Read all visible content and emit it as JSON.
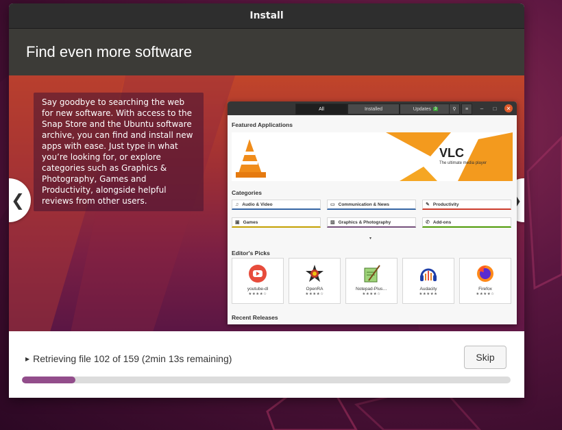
{
  "window": {
    "title": "Install"
  },
  "banner": {
    "title": "Find even more software"
  },
  "slide": {
    "description": "Say goodbye to searching the web for new software. With access to the Snap Store and the Ubuntu software archive, you can find and install new apps with ease. Just type in what you’re looking for, or explore categories such as Graphics & Photography, Games and Productivity, alongside helpful reviews from other users.",
    "prev_arrow": "❮",
    "next_arrow": "❯"
  },
  "mini_app": {
    "tabs": [
      "All",
      "Installed",
      "Updates"
    ],
    "updates_badge": "3",
    "featured_heading": "Featured Applications",
    "vlc_title": "VLC",
    "vlc_subtitle": "The ultimate media player",
    "categories_heading": "Categories",
    "categories": [
      "Audio & Video",
      "Communication & News",
      "Productivity",
      "Games",
      "Graphics & Photography",
      "Add-ons"
    ],
    "category_colors": [
      "#3465a4",
      "#3465a4",
      "#cc3b2c",
      "#c4a000",
      "#75507b",
      "#4e9a06"
    ],
    "editors_heading": "Editor's Picks",
    "picks": [
      {
        "name": "youtube-dl",
        "stars": "★★★★☆"
      },
      {
        "name": "OpenRA",
        "stars": "★★★★☆"
      },
      {
        "name": "Notepad-Plus…",
        "stars": "★★★★☆"
      },
      {
        "name": "Audacity",
        "stars": "★★★★★"
      },
      {
        "name": "Firefox",
        "stars": "★★★★☆"
      }
    ],
    "recent_heading": "Recent Releases"
  },
  "progress": {
    "status": "Retrieving file 102 of 159 (2min 13s remaining)",
    "skip_label": "Skip",
    "fraction": 0.11
  }
}
